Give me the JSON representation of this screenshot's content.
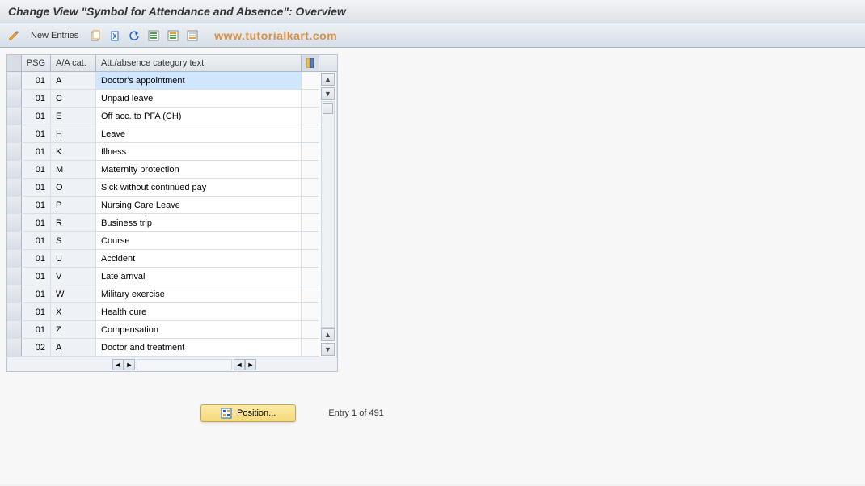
{
  "title": "Change View \"Symbol for Attendance and Absence\": Overview",
  "toolbar": {
    "new_entries": "New Entries"
  },
  "watermark": "www.tutorialkart.com",
  "columns": {
    "psg": "PSG",
    "acat": "A/A cat.",
    "text": "Att./absence category text"
  },
  "rows": [
    {
      "psg": "01",
      "acat": "A",
      "text": "Doctor's appointment",
      "selected": true
    },
    {
      "psg": "01",
      "acat": "C",
      "text": "Unpaid leave"
    },
    {
      "psg": "01",
      "acat": "E",
      "text": "Off acc. to PFA (CH)"
    },
    {
      "psg": "01",
      "acat": "H",
      "text": "Leave"
    },
    {
      "psg": "01",
      "acat": "K",
      "text": "Illness"
    },
    {
      "psg": "01",
      "acat": "M",
      "text": "Maternity protection"
    },
    {
      "psg": "01",
      "acat": "O",
      "text": "Sick without continued pay"
    },
    {
      "psg": "01",
      "acat": "P",
      "text": "Nursing Care Leave"
    },
    {
      "psg": "01",
      "acat": "R",
      "text": "Business trip"
    },
    {
      "psg": "01",
      "acat": "S",
      "text": "Course"
    },
    {
      "psg": "01",
      "acat": "U",
      "text": "Accident"
    },
    {
      "psg": "01",
      "acat": "V",
      "text": "Late arrival"
    },
    {
      "psg": "01",
      "acat": "W",
      "text": "Military exercise"
    },
    {
      "psg": "01",
      "acat": "X",
      "text": "Health cure"
    },
    {
      "psg": "01",
      "acat": "Z",
      "text": "Compensation"
    },
    {
      "psg": "02",
      "acat": "A",
      "text": "Doctor and treatment"
    }
  ],
  "footer": {
    "position_label": "Position...",
    "entry_count": "Entry 1 of 491"
  }
}
